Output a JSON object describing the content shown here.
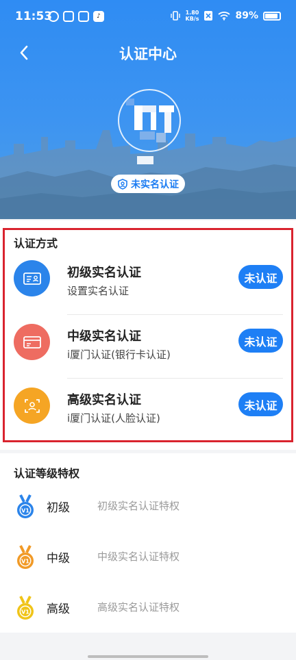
{
  "status_bar": {
    "time": "11:53",
    "tiktok_glyph": "♪",
    "speed_value": "1.80",
    "speed_unit": "KB/s",
    "battery": "89%"
  },
  "header": {
    "title": "认证中心",
    "status_badge": "未实名认证",
    "bg_color": "#2f8cf3"
  },
  "methods": {
    "section_title": "认证方式",
    "items": [
      {
        "name": "初级实名认证",
        "desc": "设置实名认证",
        "button": "未认证",
        "icon": "id-card-icon",
        "color": "#2b84ea"
      },
      {
        "name": "中级实名认证",
        "desc": "i厦门认证(银行卡认证)",
        "button": "未认证",
        "icon": "bank-card-icon",
        "color": "#ee6c61"
      },
      {
        "name": "高级实名认证",
        "desc": "i厦门认证(人脸认证)",
        "button": "未认证",
        "icon": "face-scan-icon",
        "color": "#f5a524"
      }
    ]
  },
  "privileges": {
    "section_title": "认证等级特权",
    "items": [
      {
        "level": "初级",
        "desc": "初级实名认证特权",
        "medal_text": "V1",
        "icon": "medal-blue-icon",
        "color": "#2b84ea"
      },
      {
        "level": "中级",
        "desc": "中级实名认证特权",
        "medal_text": "V1",
        "icon": "medal-orange-icon",
        "color": "#f19a27"
      },
      {
        "level": "高级",
        "desc": "高级实名认证特权",
        "medal_text": "V1",
        "icon": "medal-gold-icon",
        "color": "#f0c419"
      }
    ]
  }
}
